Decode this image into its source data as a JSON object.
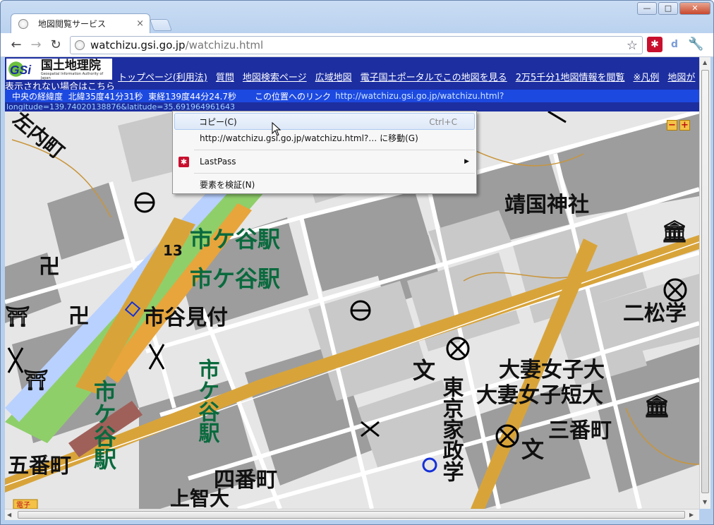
{
  "browser": {
    "tab_title": "地図閲覧サービス",
    "tab_close": "×",
    "url_host": "watchizu.gsi.go.jp",
    "url_path": "/watchizu.html",
    "window_buttons": {
      "minimize": "—",
      "maximize": "□",
      "close": "✕"
    }
  },
  "header": {
    "logo_title": "国土地理院",
    "logo_subtitle": "Geospatial Information Authority of Japan",
    "nav_links": [
      "トップページ(利用法)",
      "質問",
      "地図検索ページ",
      "広域地図",
      "電子国土ポータルでこの地図を見る",
      "2万5千分1地図情報を閲覧",
      "※凡例",
      "地図が"
    ],
    "fallback_link": "表示されない場合はこちら"
  },
  "coord_bar": {
    "label": "中央の経緯度",
    "lat": "北緯35度41分31秒",
    "lon": "東経139度44分24.7秒",
    "link_label": "この位置へのリンク",
    "link_url": "http://watchizu.gsi.go.jp/watchizu.html?"
  },
  "url_params": "longitude=139.74020138876&latitude=35.691964961643",
  "map": {
    "labels": {
      "ichigaya_station_1": "市ケ谷駅",
      "ichigaya_station_2": "市ケ谷駅",
      "ichigaya_mitsuke": "市谷見付",
      "yasukuni": "靖国神社",
      "nibancho": "二松学",
      "otsuma_univ": "大妻女子大",
      "otsuma_jc": "大妻女子短大",
      "sanbancho": "三番町",
      "gobancho": "五番町",
      "yonbancho": "四番町",
      "tokyo_kasei": "東京家政学",
      "vert_ichigaya_1": "市ケ谷駅",
      "vert_ichigaya_2": "市ケ谷駅",
      "number_13": "13",
      "jochi": "上智大",
      "corner_badge": "電子",
      "fragment_top_left": "左内町"
    },
    "zoom_minus": "−",
    "zoom_plus": "+"
  },
  "context_menu": {
    "items": [
      {
        "label": "コピー(C)",
        "shortcut": "Ctrl+C"
      },
      {
        "label": "http://watchizu.gsi.go.jp/watchizu.html?… に移動(G)"
      },
      {
        "label": "LastPass",
        "icon": "lastpass-icon",
        "submenu": "▶"
      },
      {
        "label": "要素を検証(N)"
      }
    ]
  },
  "colors": {
    "header_bg": "#1c2ea0",
    "coord_bg": "#1c49e0",
    "station_text": "#0a6a3e",
    "railway_green": "#8fcf6a",
    "railway_blue": "#b9d1ff",
    "road_yellow": "#d8a43a"
  }
}
